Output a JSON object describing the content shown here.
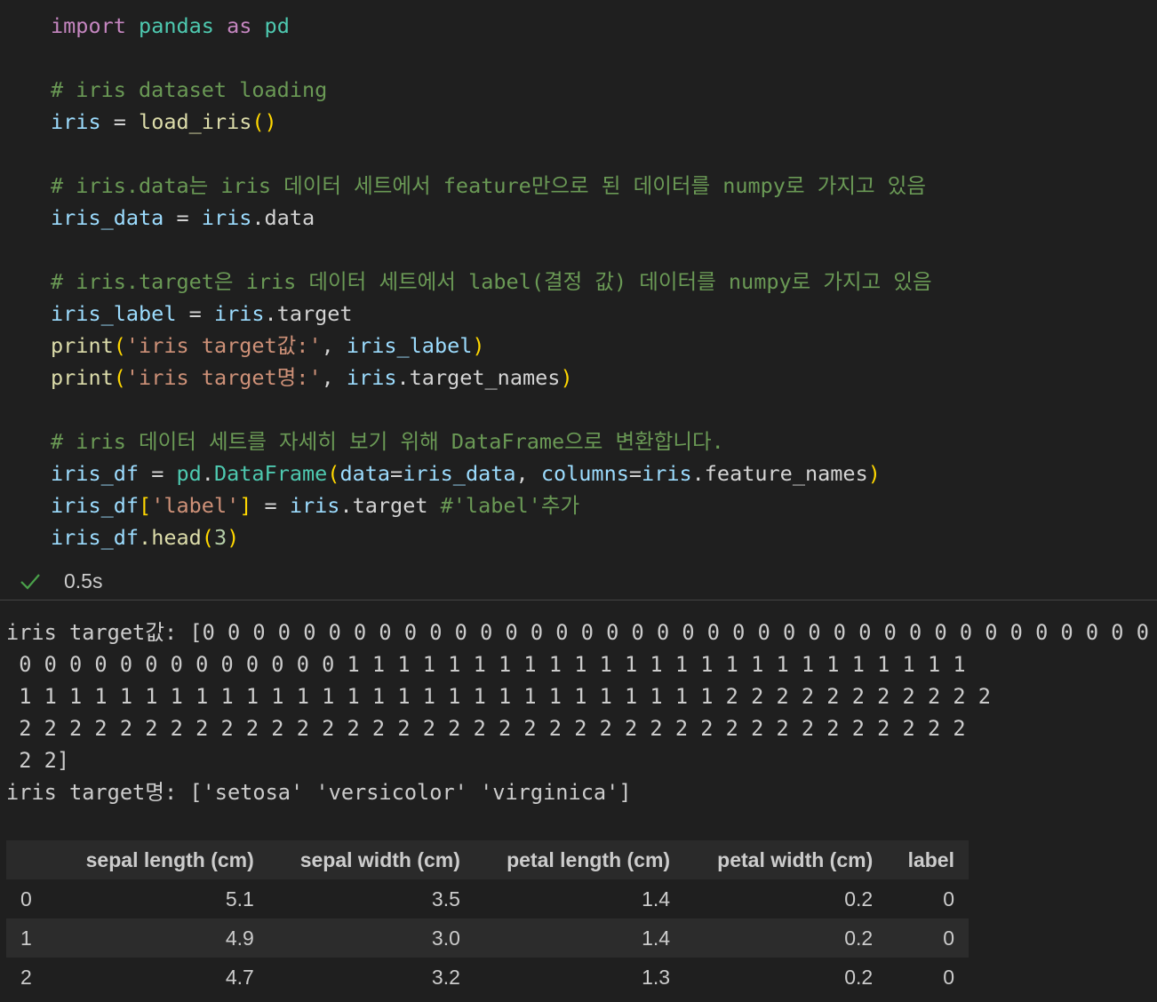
{
  "code": {
    "l1": {
      "import": "import",
      "pandas": "pandas",
      "as": "as",
      "pd": "pd"
    },
    "l2": "# iris dataset loading",
    "l3": {
      "iris": "iris",
      "eq": " = ",
      "fn": "load_iris",
      "paren": "()"
    },
    "l4": "# iris.data는 iris 데이터 세트에서 feature만으로 된 데이터를 numpy로 가지고 있음",
    "l5": {
      "var": "iris_data",
      "eq": " = ",
      "obj": "iris",
      "attr": ".data"
    },
    "l6": "# iris.target은 iris 데이터 세트에서 label(결정 값) 데이터를 numpy로 가지고 있음",
    "l7": {
      "var": "iris_label",
      "eq": " = ",
      "obj": "iris",
      "attr": ".target"
    },
    "l8": {
      "fn": "print",
      "open": "(",
      "str": "'iris target값:'",
      "comma": ", ",
      "arg": "iris_label",
      "close": ")"
    },
    "l9": {
      "fn": "print",
      "open": "(",
      "str": "'iris target명:'",
      "comma": ", ",
      "obj": "iris",
      "attr": ".target_names",
      "close": ")"
    },
    "l10": "# iris 데이터 세트를 자세히 보기 위해 DataFrame으로 변환합니다.",
    "l11": {
      "var": "iris_df",
      "eq": " = ",
      "mod": "pd",
      "dot": ".",
      "fn": "DataFrame",
      "open": "(",
      "k1": "data",
      "e1": "=",
      "v1": "iris_data",
      "comma": ", ",
      "k2": "columns",
      "e2": "=",
      "v2": "iris",
      "attr": ".feature_names",
      "close": ")"
    },
    "l12": {
      "var": "iris_df",
      "open": "[",
      "str": "'label'",
      "close": "]",
      "eq": " = ",
      "obj": "iris",
      "attr": ".target ",
      "cm": "#'label'추가"
    },
    "l13": {
      "var": "iris_df",
      "attr": ".head",
      "open": "(",
      "num": "3",
      "close": ")"
    }
  },
  "status": {
    "exec_time": "0.5s"
  },
  "colors": {
    "success": "#4aa14a"
  },
  "output": {
    "lines": [
      "iris target값: [0 0 0 0 0 0 0 0 0 0 0 0 0 0 0 0 0 0 0 0 0 0 0 0 0 0 0 0 0 0 0 0 0 0 0 0 0 0 0 0",
      " 0 0 0 0 0 0 0 0 0 0 0 0 0 1 1 1 1 1 1 1 1 1 1 1 1 1 1 1 1 1 1 1 1 1 1 1 1 1",
      " 1 1 1 1 1 1 1 1 1 1 1 1 1 1 1 1 1 1 1 1 1 1 1 1 1 1 1 1 2 2 2 2 2 2 2 2 2 2 2",
      " 2 2 2 2 2 2 2 2 2 2 2 2 2 2 2 2 2 2 2 2 2 2 2 2 2 2 2 2 2 2 2 2 2 2 2 2 2 2",
      " 2 2]",
      "iris target명: ['setosa' 'versicolor' 'virginica']"
    ]
  },
  "dataframe": {
    "columns": [
      "",
      "sepal length (cm)",
      "sepal width (cm)",
      "petal length (cm)",
      "petal width (cm)",
      "label"
    ],
    "rows": [
      [
        "0",
        "5.1",
        "3.5",
        "1.4",
        "0.2",
        "0"
      ],
      [
        "1",
        "4.9",
        "3.0",
        "1.4",
        "0.2",
        "0"
      ],
      [
        "2",
        "4.7",
        "3.2",
        "1.3",
        "0.2",
        "0"
      ]
    ]
  }
}
